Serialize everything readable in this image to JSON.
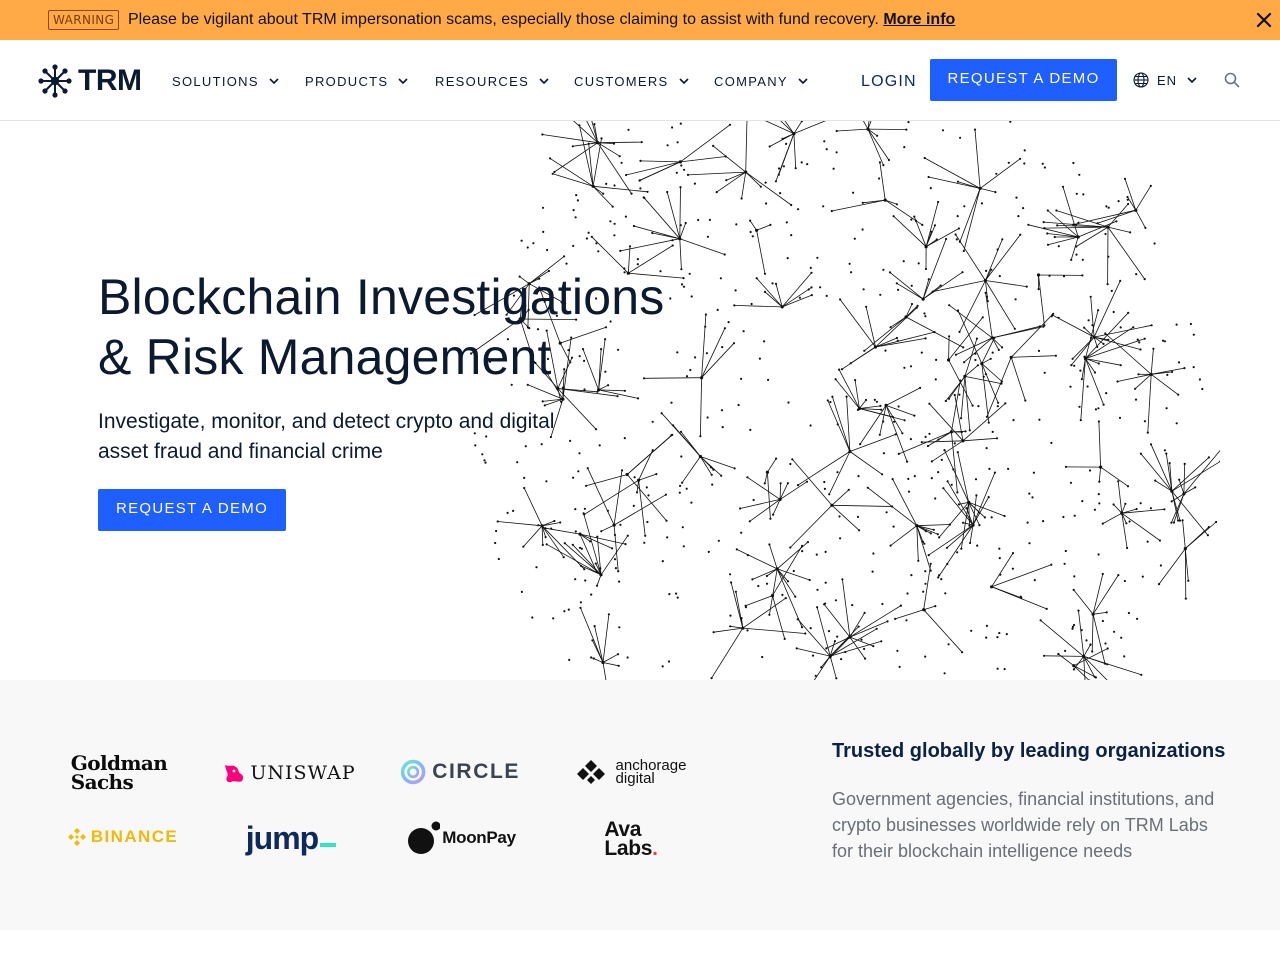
{
  "warning": {
    "badge": "WARNING",
    "message": "Please be vigilant about TRM impersonation scams, especially those claiming to assist with fund recovery. ",
    "link": "More info"
  },
  "header": {
    "logo_text": "TRM",
    "nav": [
      {
        "label": "SOLUTIONS"
      },
      {
        "label": "PRODUCTS"
      },
      {
        "label": "RESOURCES"
      },
      {
        "label": "CUSTOMERS"
      },
      {
        "label": "COMPANY"
      }
    ],
    "login": "LOGIN",
    "cta": "REQUEST A DEMO",
    "lang": "EN"
  },
  "hero": {
    "title_line1": "Blockchain Investigations",
    "title_line2": "& Risk Management",
    "subtitle": "Investigate, monitor, and detect crypto and digital asset fraud and financial crime",
    "cta": "REQUEST A DEMO"
  },
  "trusted": {
    "title": "Trusted globally by leading organizations",
    "description": "Government agencies, financial institutions, and crypto businesses worldwide rely on TRM Labs for their blockchain intelligence needs",
    "logos": {
      "goldman_line1": "Goldman",
      "goldman_line2": "Sachs",
      "uniswap": "UNISWAP",
      "circle": "CIRCLE",
      "anchorage_line1": "anchorage",
      "anchorage_line2": "digital",
      "binance": "BINANCE",
      "jump": "jump",
      "moonpay": "MoonPay",
      "ava_line1": "Ava",
      "ava_line2": "Labs"
    }
  },
  "colors": {
    "warning_bg": "#ffa947",
    "primary": "#1f5fff",
    "navy": "#0b1a2e",
    "section_bg": "#f8f8f8",
    "binance_yellow": "#f0b90b",
    "uniswap_pink": "#ff007a",
    "jump_teal": "#2ee6c4",
    "ava_red": "#e84142"
  }
}
